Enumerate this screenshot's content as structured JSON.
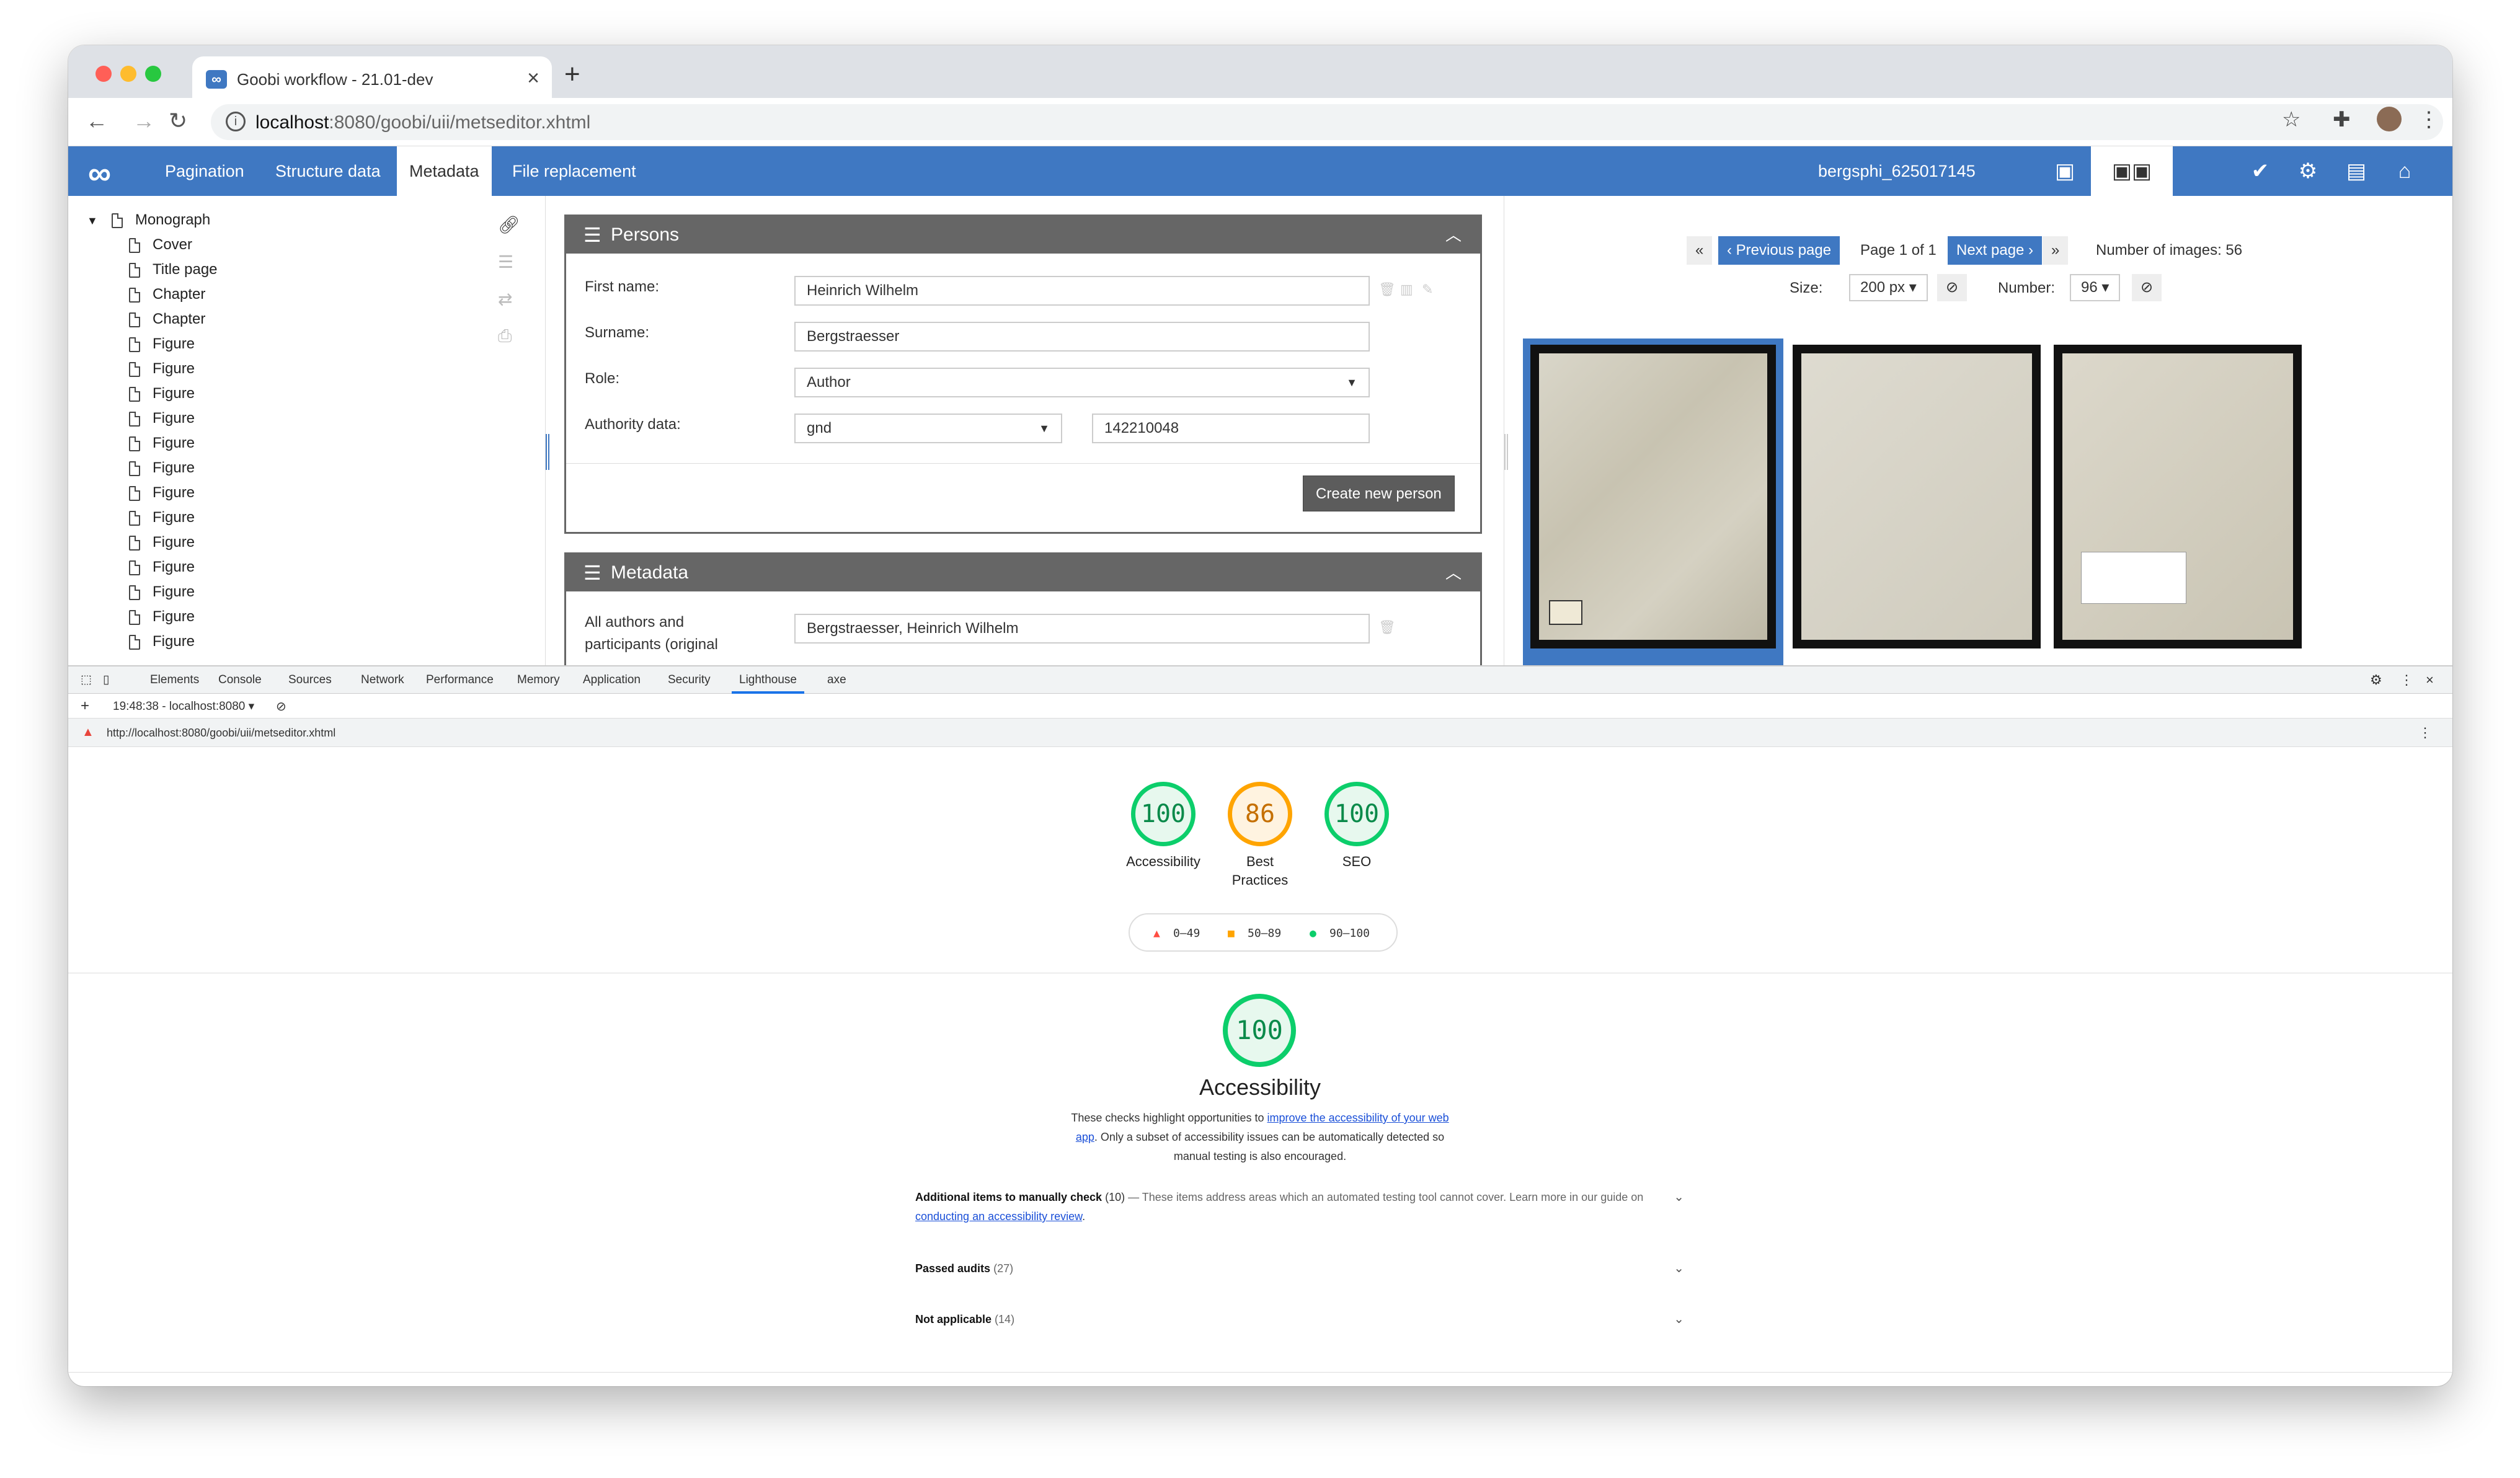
{
  "browser": {
    "tab_title": "Goobi workflow - 21.01-dev",
    "url_host": "localhost",
    "url_path": ":8080/goobi/uii/metseditor.xhtml"
  },
  "app_nav": {
    "tabs": [
      "Pagination",
      "Structure data",
      "Metadata",
      "File replacement"
    ],
    "active_tab": "Metadata",
    "record_id": "bergsphi_625017145"
  },
  "tree": {
    "root": "Monograph",
    "items": [
      "Cover",
      "Title page",
      "Chapter",
      "Chapter",
      "Figure",
      "Figure",
      "Figure",
      "Figure",
      "Figure",
      "Figure",
      "Figure",
      "Figure",
      "Figure",
      "Figure",
      "Figure",
      "Figure",
      "Figure"
    ]
  },
  "persons_panel": {
    "title": "Persons",
    "first_name_label": "First name:",
    "first_name": "Heinrich Wilhelm",
    "surname_label": "Surname:",
    "surname": "Bergstraesser",
    "role_label": "Role:",
    "role": "Author",
    "authority_label": "Authority data:",
    "authority_source": "gnd",
    "authority_id": "142210048",
    "create_button": "Create new person"
  },
  "metadata_panel": {
    "title": "Metadata",
    "field_label_line1": "All authors and",
    "field_label_line2": "participants (original",
    "field_value": "Bergstraesser, Heinrich Wilhelm"
  },
  "image_pager": {
    "first": "«",
    "prev": "‹ Previous page",
    "page_info": "Page 1 of 1",
    "next": "Next page ›",
    "last": "»",
    "count_text": "Number of images: 56",
    "size_label": "Size:",
    "size_value": "200 px",
    "number_label": "Number:",
    "number_value": "96"
  },
  "devtools": {
    "tabs": [
      "Elements",
      "Console",
      "Sources",
      "Network",
      "Performance",
      "Memory",
      "Application",
      "Security",
      "Lighthouse",
      "axe"
    ],
    "active_tab": "Lighthouse",
    "report_selector": "19:48:38 - localhost:8080",
    "report_url": "http://localhost:8080/goobi/uii/metseditor.xhtml"
  },
  "lighthouse": {
    "scores": [
      {
        "label": "Accessibility",
        "value": "100"
      },
      {
        "label": "Best Practices",
        "value": "86"
      },
      {
        "label": "SEO",
        "value": "100"
      }
    ],
    "legend": [
      "0–49",
      "50–89",
      "90–100"
    ],
    "category_score": "100",
    "category_title": "Accessibility",
    "desc_pre": "These checks highlight opportunities to ",
    "desc_link": "improve the accessibility of your web app",
    "desc_post": ". Only a subset of accessibility issues can be automatically detected so manual testing is also encouraged.",
    "manual_title": "Additional items to manually check",
    "manual_count": "(10)",
    "manual_desc": " — These items address areas which an automated testing tool cannot cover. Learn more in our guide on ",
    "manual_link": "conducting an accessibility review",
    "passed_title": "Passed audits",
    "passed_count": "(27)",
    "na_title": "Not applicable",
    "na_count": "(14)"
  },
  "colors": {
    "brand": "#3f78c2",
    "pass": "#0cce6b",
    "average": "#ffa400",
    "fail": "#ff4e42"
  }
}
